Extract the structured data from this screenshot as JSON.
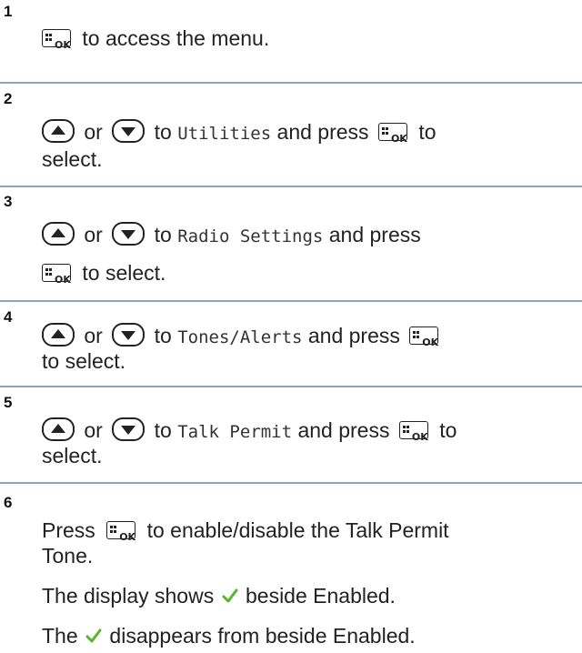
{
  "steps": [
    {
      "num": "1",
      "text_after_key": "to access the menu."
    },
    {
      "num": "2",
      "or": "or",
      "to": "to",
      "menu_item": "Utilities",
      "and_press": "and press",
      "tail": "to",
      "cont": "select."
    },
    {
      "num": "3",
      "or": "or",
      "to": "to",
      "menu_item": "Radio Settings",
      "and_press": "and press",
      "line2": "to select."
    },
    {
      "num": "4",
      "or": "or",
      "to": "to",
      "menu_item": "Tones/Alerts",
      "and_press": "and press",
      "cont": "to select."
    },
    {
      "num": "5",
      "or": "or",
      "to": "to",
      "menu_item": "Talk Permit",
      "and_press": "and press",
      "tail": "to",
      "cont": "select."
    },
    {
      "num": "6",
      "press": "Press",
      "line1": "to enable/disable the Talk Permit",
      "line2": "Tone.",
      "result1_pre": "The display shows",
      "result1_post": "beside Enabled.",
      "result2_pre": "The",
      "result2_post": "disappears from beside Enabled."
    }
  ],
  "icons": {
    "ok_key": "ok-key-icon",
    "up_key": "up-arrow-key-icon",
    "down_key": "down-arrow-key-icon",
    "check": "checkmark-icon"
  },
  "colors": {
    "divider": "#8fa3b9",
    "check": "#5cb32e"
  }
}
